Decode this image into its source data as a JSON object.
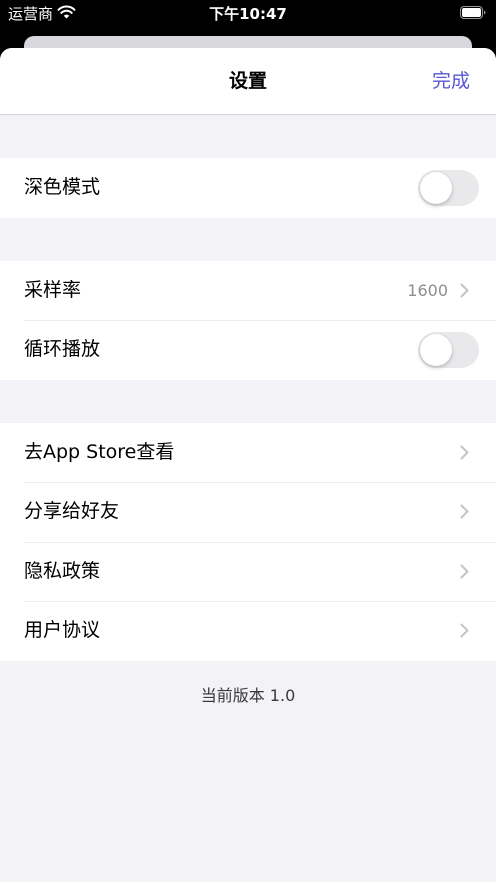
{
  "status_bar": {
    "carrier": "运营商",
    "time": "下午10:47",
    "wifi_icon": "wifi-icon",
    "battery_icon": "battery-icon",
    "battery_level": 1.0
  },
  "header": {
    "title": "设置",
    "done_label": "完成"
  },
  "sections": [
    {
      "rows": [
        {
          "label": "深色模式",
          "type": "toggle",
          "on": false
        }
      ]
    },
    {
      "rows": [
        {
          "label": "采样率",
          "type": "value",
          "value": "1600",
          "icon": "chevron-right-icon"
        },
        {
          "label": "循环播放",
          "type": "toggle",
          "on": false
        }
      ]
    },
    {
      "rows": [
        {
          "label": "去App Store查看",
          "type": "link",
          "icon": "chevron-right-icon"
        },
        {
          "label": "分享给好友",
          "type": "link",
          "icon": "chevron-right-icon"
        },
        {
          "label": "隐私政策",
          "type": "link",
          "icon": "chevron-right-icon"
        },
        {
          "label": "用户协议",
          "type": "link",
          "icon": "chevron-right-icon"
        }
      ]
    }
  ],
  "footer": {
    "version": "当前版本 1.0"
  },
  "colors": {
    "accent": "#5856d6",
    "grouped_background": "#f2f2f7",
    "row_background": "#ffffff",
    "secondary_text": "#8e8e93",
    "chevron": "#c4c4c7",
    "toggle_off": "#e9e9eb"
  }
}
